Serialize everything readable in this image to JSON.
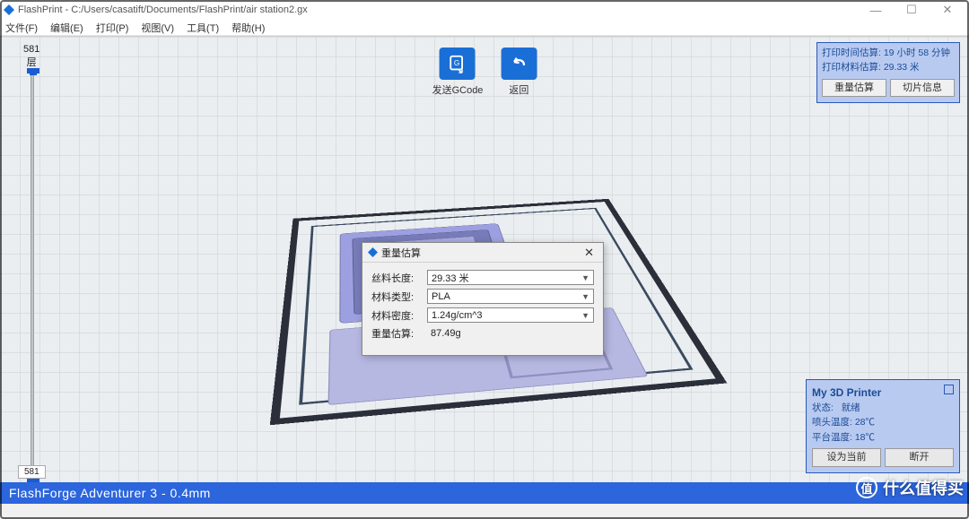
{
  "window": {
    "title": "FlashPrint - C:/Users/casatift/Documents/FlashPrint/air station2.gx",
    "min": "—",
    "max": "☐",
    "close": "✕"
  },
  "menu": {
    "file": "文件(F)",
    "edit": "编辑(E)",
    "print": "打印(P)",
    "view": "视图(V)",
    "tools": "工具(T)",
    "help": "帮助(H)"
  },
  "layers": {
    "top": "581",
    "label": "层",
    "bottom": "581"
  },
  "toolbar": {
    "send_gcode": "发送GCode",
    "back": "返回"
  },
  "estimate": {
    "time_label": "打印时间估算:",
    "time_value": "19 小时 58 分钟",
    "material_label": "打印材料估算:",
    "material_value": "29.33 米",
    "btn_weight": "重量估算",
    "btn_slice": "切片信息"
  },
  "modal": {
    "title": "重量估算",
    "rows": {
      "filament_len_label": "丝料长度:",
      "filament_len_value": "29.33 米",
      "material_type_label": "材料类型:",
      "material_type_value": "PLA",
      "density_label": "材料密度:",
      "density_value": "1.24g/cm^3",
      "weight_label": "重量估算:",
      "weight_value": "87.49g"
    },
    "close": "✕"
  },
  "printer": {
    "title": "My 3D Printer",
    "status_label": "状态:",
    "status_value": "就绪",
    "nozzle_label": "喷头温度:",
    "nozzle_value": "28℃",
    "bed_label": "平台温度:",
    "bed_value": "18℃",
    "btn_current": "设为当前",
    "btn_disconnect": "断开"
  },
  "footer": {
    "text": "FlashForge Adventurer 3 - 0.4mm"
  },
  "watermark": {
    "icon": "值",
    "text": "什么值得买"
  }
}
